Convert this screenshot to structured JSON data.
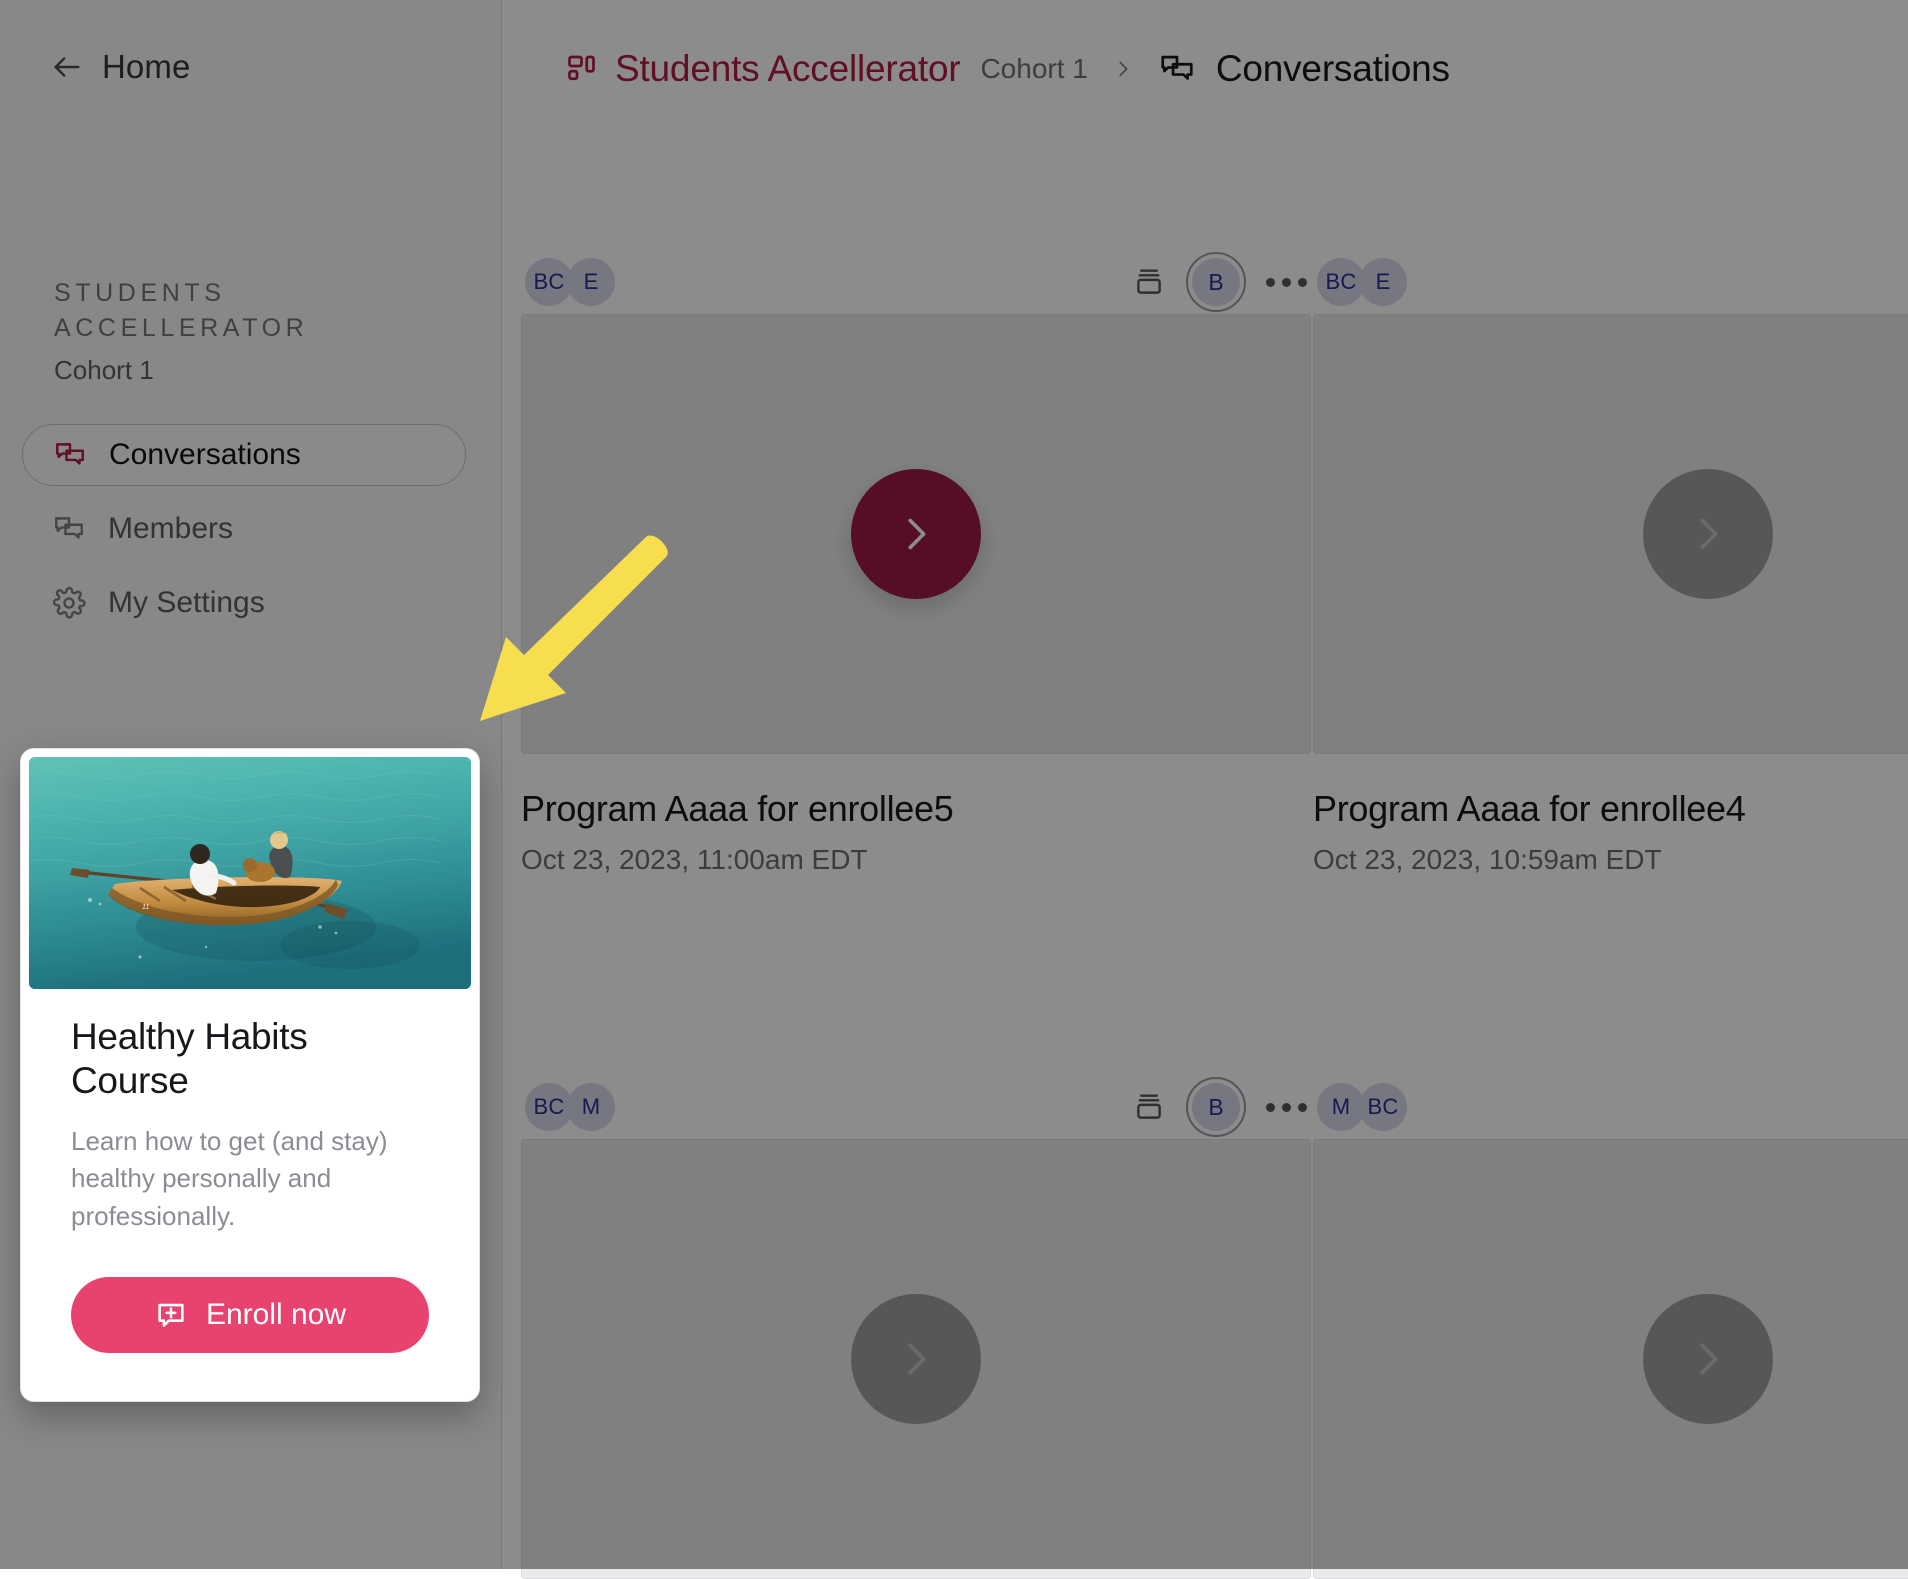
{
  "sidebar": {
    "back": {
      "label": "Home",
      "icon": "arrow-left-icon"
    },
    "workspace": {
      "title": "STUDENTS ACCELLERATOR",
      "subtitle": "Cohort 1"
    },
    "nav_items": [
      {
        "label": "Conversations",
        "icon": "conversations-icon",
        "active": true
      },
      {
        "label": "Members",
        "icon": "members-icon",
        "active": false
      },
      {
        "label": "My Settings",
        "icon": "gear-icon",
        "active": false
      }
    ]
  },
  "breadcrumb": {
    "brand_icon": "workspace-icon",
    "brand": "Students Accellerator",
    "cohort": "Cohort 1",
    "separator_icon": "chevron-right-icon",
    "page_icon": "conversations-icon",
    "page": "Conversations"
  },
  "conversations": [
    {
      "participants": [
        "BC",
        "E"
      ],
      "owner": "B",
      "title": "Program Aaaa for enrollee5",
      "date": "Oct 23, 2023, 11:00am EDT",
      "play_primary": true,
      "has_actions": true
    },
    {
      "participants": [
        "BC",
        "E"
      ],
      "owner": "",
      "title": "Program Aaaa for enrollee4",
      "date": "Oct 23, 2023, 10:59am EDT",
      "play_primary": false,
      "has_actions": false
    },
    {
      "participants": [
        "BC",
        "M"
      ],
      "owner": "B",
      "title": "",
      "date": "",
      "play_primary": false,
      "has_actions": true
    },
    {
      "participants": [
        "M",
        "BC"
      ],
      "owner": "",
      "title": "",
      "date": "",
      "play_primary": false,
      "has_actions": false
    }
  ],
  "promo_card": {
    "image_alt": "rowboat-on-turquoise-water-photo",
    "title": "Healthy Habits Course",
    "description": "Learn how to get (and stay) healthy personally and professionally.",
    "cta_label": "Enroll now",
    "cta_icon": "add-conversation-icon"
  },
  "annotation": {
    "type": "arrow",
    "color": "#F7DE4E",
    "points_to": "promo-card"
  },
  "colors": {
    "brand_crimson": "#b01c43",
    "play_primary": "#9b1b42",
    "cta_pink": "#e8436f",
    "avatar_bg": "#d7d9ea",
    "avatar_text": "#2d2f8f",
    "annotation_yellow": "#F7DE4E"
  }
}
